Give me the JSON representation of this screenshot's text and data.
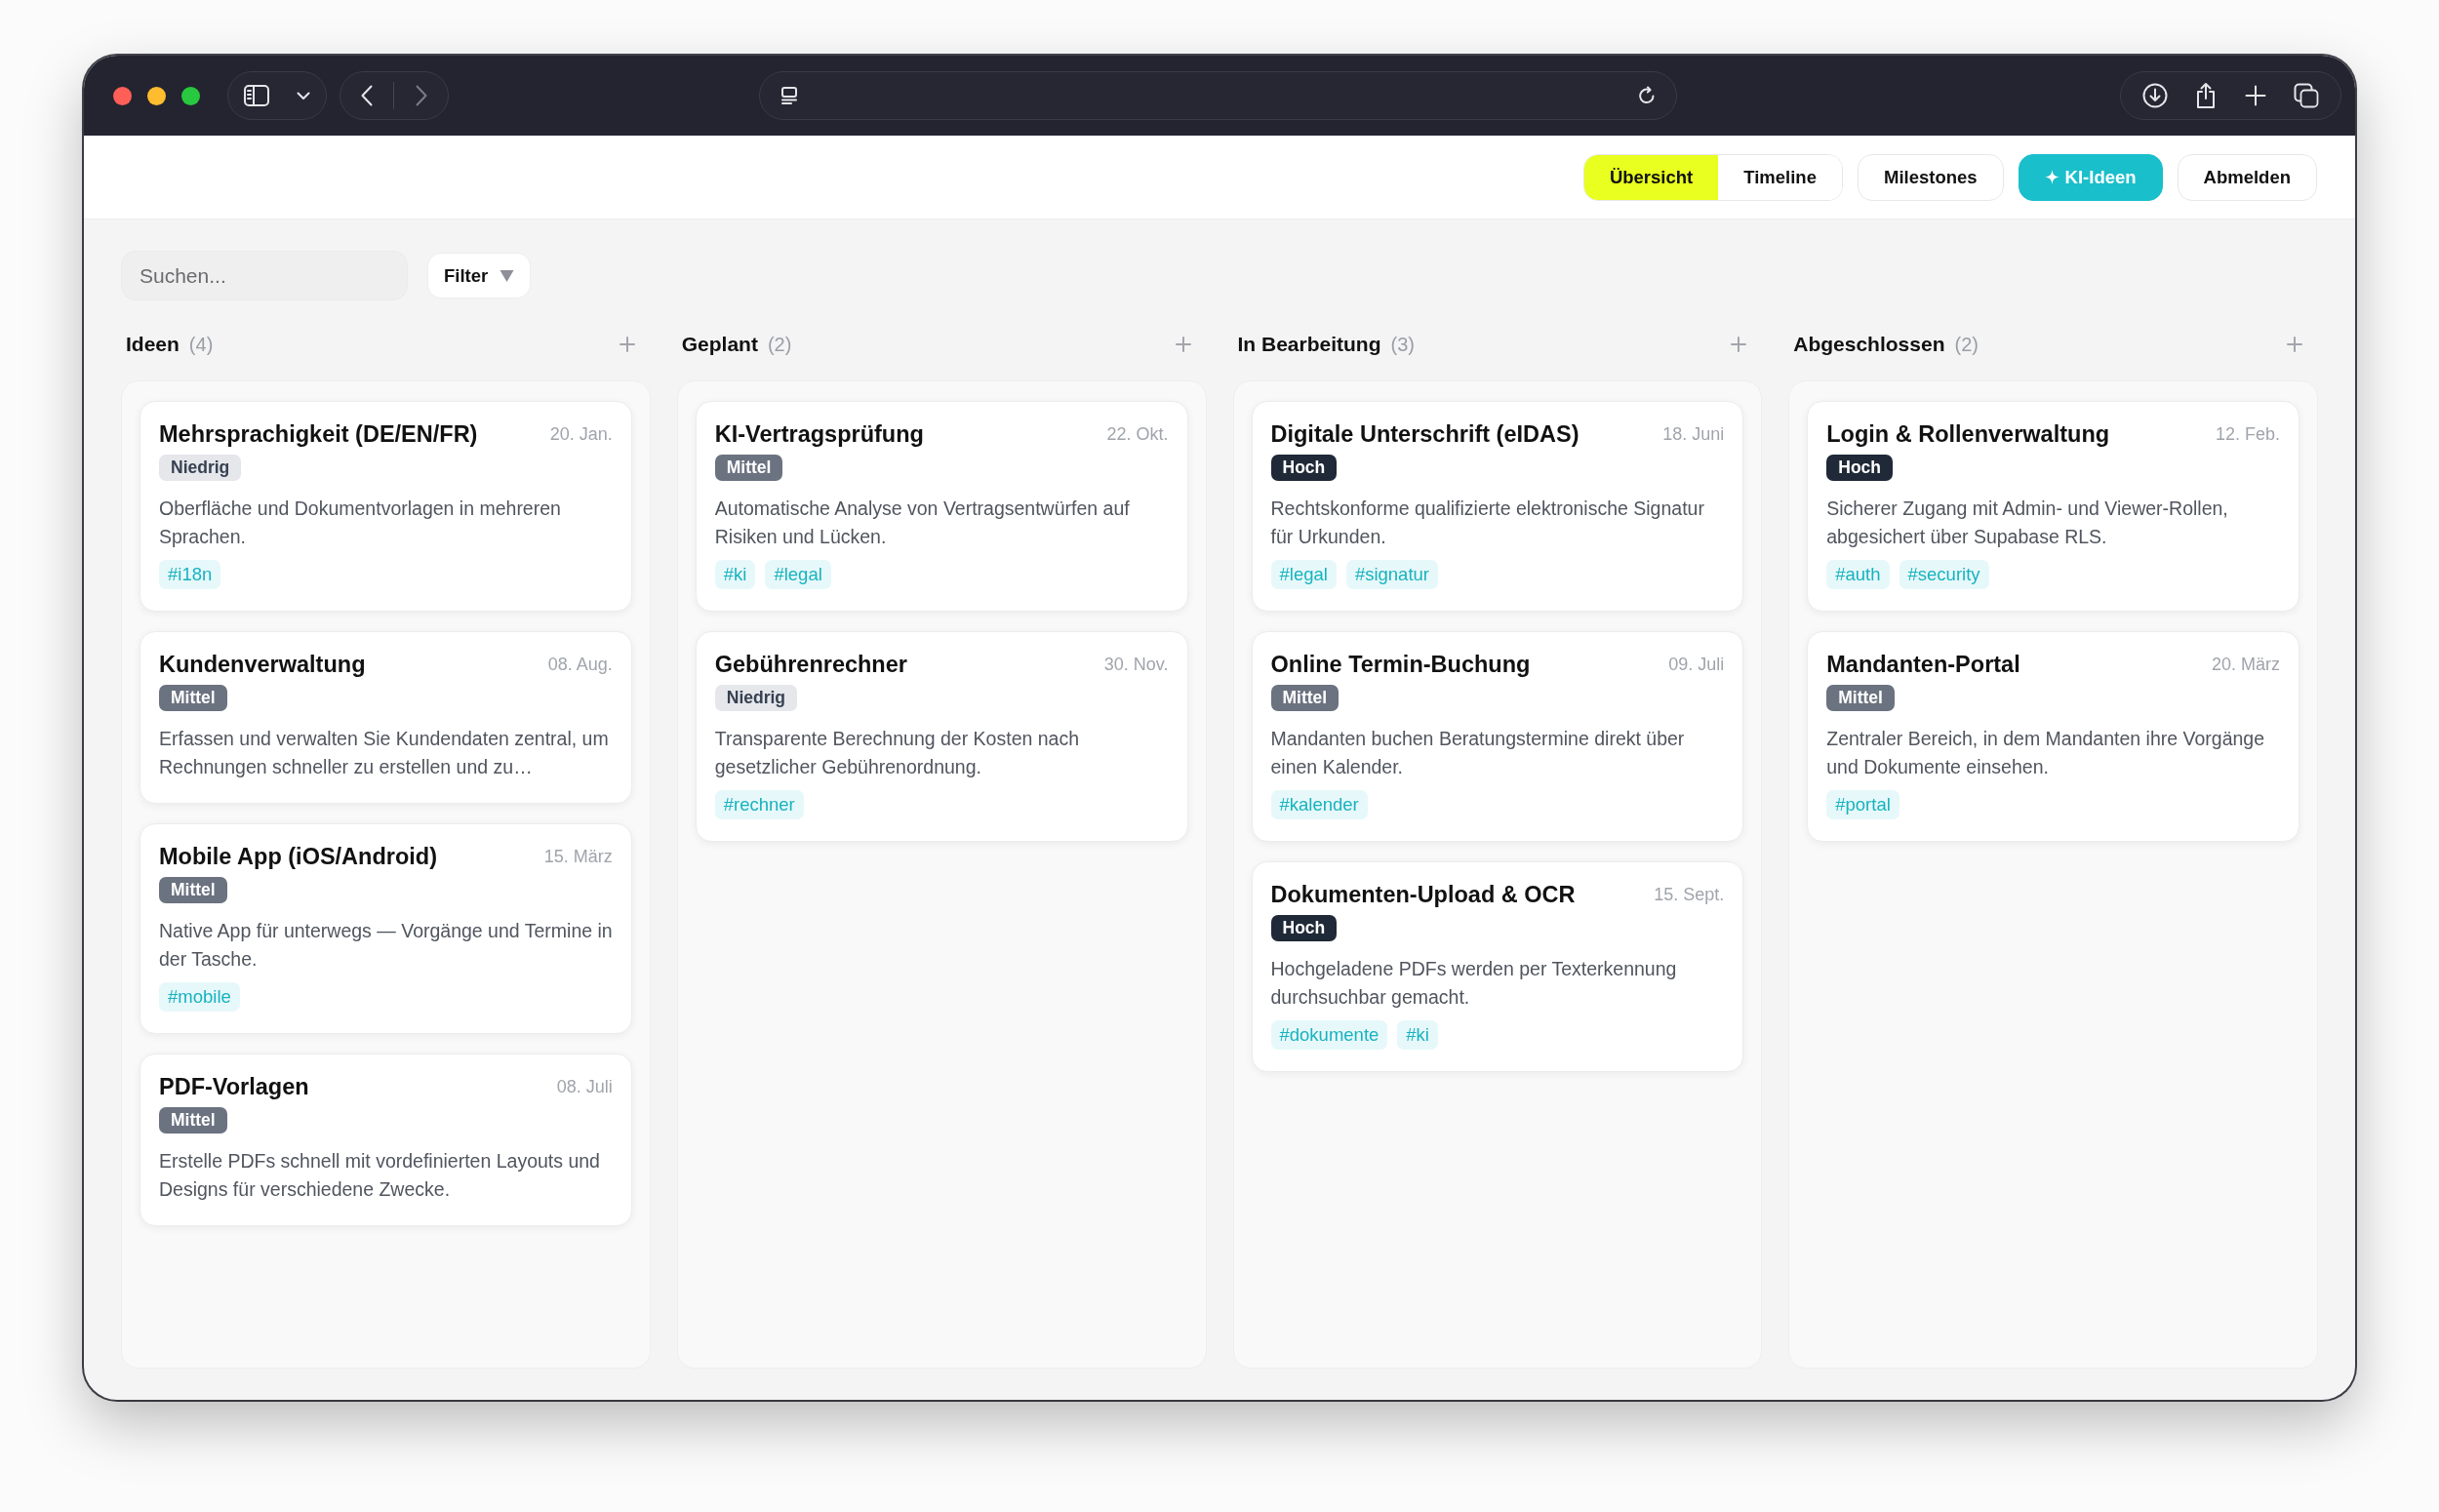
{
  "browser": {
    "forward_disabled": true
  },
  "header": {
    "view_switch": [
      {
        "label": "Übersicht",
        "selected": true
      },
      {
        "label": "Timeline",
        "selected": false
      }
    ],
    "buttons": [
      {
        "label": "Milestones",
        "kind": "outline"
      },
      {
        "label": "KI-Ideen",
        "kind": "accent"
      },
      {
        "label": "Abmelden",
        "kind": "outline"
      }
    ]
  },
  "toolbar": {
    "search": {
      "placeholder": "Suchen..."
    },
    "filter": {
      "label": "Filter"
    }
  },
  "columns": [
    {
      "title": "Ideen",
      "count": "(4)",
      "cards": [
        {
          "title": "Mehrsprachigkeit (DE/EN/FR)",
          "date": "20. Jan.",
          "priority": {
            "label": "Niedrig",
            "kind": "low"
          },
          "description": "Oberfläche und Dokumentvorlagen in mehreren Sprachen.",
          "tags": [
            "#i18n"
          ]
        },
        {
          "title": "Kundenverwaltung",
          "date": "08. Aug.",
          "priority": {
            "label": "Mittel",
            "kind": "medium"
          },
          "description": "Erfassen und verwalten Sie Kundendaten zentral, um Rechnungen schneller zu erstellen und zu…"
        },
        {
          "title": "Mobile App (iOS/Android)",
          "date": "15. März",
          "priority": {
            "label": "Mittel",
            "kind": "medium"
          },
          "description": "Native App für unterwegs — Vorgänge und Termine in der Tasche.",
          "tags": [
            "#mobile"
          ]
        },
        {
          "title": "PDF-Vorlagen",
          "date": "08. Juli",
          "priority": {
            "label": "Mittel",
            "kind": "medium"
          },
          "description": "Erstelle PDFs schnell mit vordefinierten Layouts und Designs für verschiedene Zwecke."
        }
      ]
    },
    {
      "title": "Geplant",
      "count": "(2)",
      "cards": [
        {
          "title": "KI-Vertragsprüfung",
          "date": "22. Okt.",
          "priority": {
            "label": "Mittel",
            "kind": "medium"
          },
          "description": "Automatische Analyse von Vertragsentwürfen auf Risiken und Lücken.",
          "tags": [
            "#ki",
            "#legal"
          ]
        },
        {
          "title": "Gebührenrechner",
          "date": "30. Nov.",
          "priority": {
            "label": "Niedrig",
            "kind": "low"
          },
          "description": "Transparente Berechnung der Kosten nach gesetzlicher Gebührenordnung.",
          "tags": [
            "#rechner"
          ]
        }
      ]
    },
    {
      "title": "In Bearbeitung",
      "count": "(3)",
      "cards": [
        {
          "title": "Digitale Unterschrift (eIDAS)",
          "date": "18. Juni",
          "priority": {
            "label": "Hoch",
            "kind": "high"
          },
          "description": "Rechtskonforme qualifizierte elektronische Signatur für Urkunden.",
          "tags": [
            "#legal",
            "#signatur"
          ]
        },
        {
          "title": "Online Termin-Buchung",
          "date": "09. Juli",
          "priority": {
            "label": "Mittel",
            "kind": "medium"
          },
          "description": "Mandanten buchen Beratungstermine direkt über einen Kalender.",
          "tags": [
            "#kalender"
          ]
        },
        {
          "title": "Dokumenten-Upload & OCR",
          "date": "15. Sept.",
          "priority": {
            "label": "Hoch",
            "kind": "high"
          },
          "description": "Hochgeladene PDFs werden per Texterkennung durchsuchbar gemacht.",
          "tags": [
            "#dokumente",
            "#ki"
          ]
        }
      ]
    },
    {
      "title": "Abgeschlossen",
      "count": "(2)",
      "cards": [
        {
          "title": "Login & Rollenverwaltung",
          "date": "12. Feb.",
          "priority": {
            "label": "Hoch",
            "kind": "high"
          },
          "description": "Sicherer Zugang mit Admin- und Viewer-Rollen, abgesichert über Supabase RLS.",
          "tags": [
            "#auth",
            "#security"
          ]
        },
        {
          "title": "Mandanten-Portal",
          "date": "20. März",
          "priority": {
            "label": "Mittel",
            "kind": "medium"
          },
          "description": "Zentraler Bereich, in dem Mandanten ihre Vorgänge und Dokumente einsehen.",
          "tags": [
            "#portal"
          ]
        }
      ]
    }
  ]
}
